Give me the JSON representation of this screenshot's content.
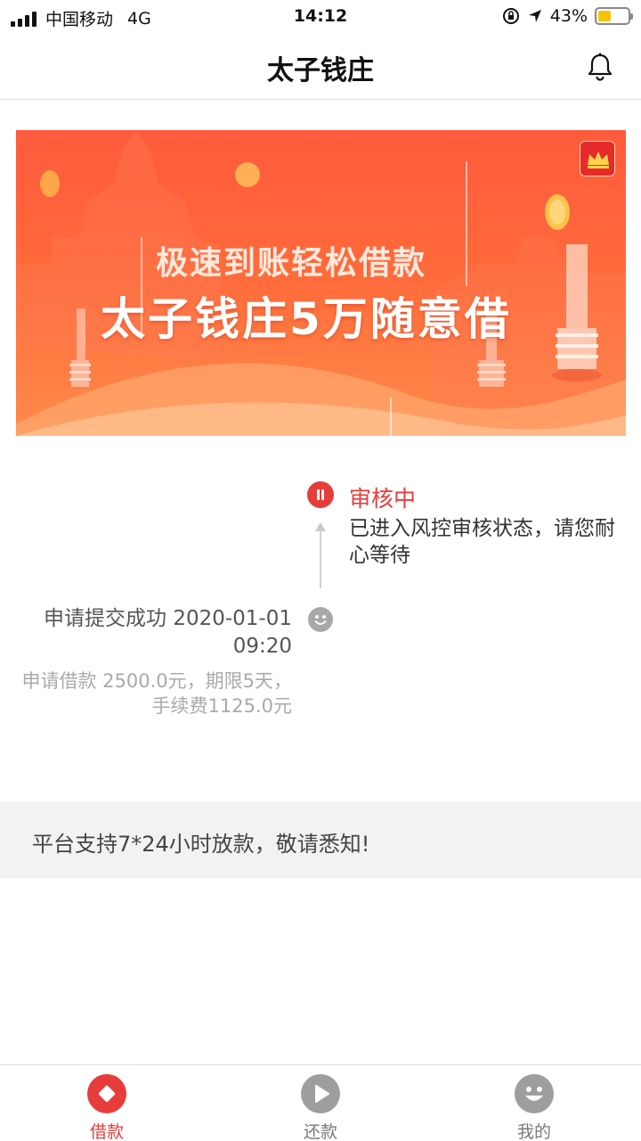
{
  "status_bar": {
    "carrier": "中国移动",
    "network": "4G",
    "time": "14:12",
    "battery": "43%",
    "battery_level": 0.43
  },
  "nav": {
    "title": "太子钱庄",
    "bell_icon": "bell-icon"
  },
  "banner": {
    "line1": "极速到账轻松借款",
    "line2": "太子钱庄5万随意借"
  },
  "timeline": {
    "review": {
      "title": "审核中",
      "desc": "已进入风控审核状态，请您耐心等待",
      "icon": "pause-icon",
      "color": "#e63d3a"
    },
    "submit": {
      "title": "申请提交成功 2020-01-01 09:20",
      "desc": "申请借款 2500.0元，期限5天，手续费1125.0元",
      "icon": "smiley-icon"
    }
  },
  "notice": {
    "text": "平台支持7*24小时放款，敬请悉知!"
  },
  "tabs": [
    {
      "label": "借款",
      "icon": "diamond-icon",
      "active": true,
      "color": "#e63d3a"
    },
    {
      "label": "还款",
      "icon": "play-icon",
      "active": false,
      "color": "#9e9e9e"
    },
    {
      "label": "我的",
      "icon": "smiley-icon",
      "active": false,
      "color": "#9e9e9e"
    }
  ]
}
